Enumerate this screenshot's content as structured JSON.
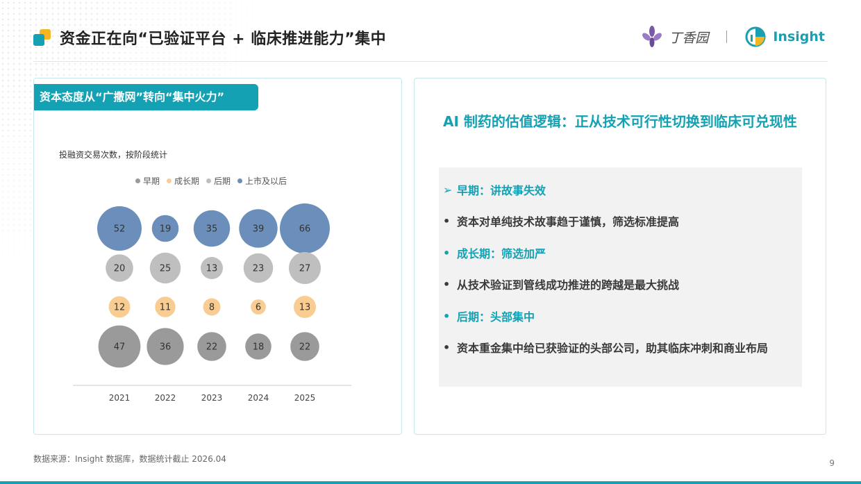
{
  "header": {
    "title": "资金正在向“已验证平台 + 临床推进能力”集中",
    "logo_lilac": "丁香园",
    "logo_insight": "Insight"
  },
  "left_panel": {
    "tag": "资本态度从“广撒网”转向“集中火力”",
    "chart_subtitle": "投融资交易易次数，按阶段统计"
  },
  "chart_data": {
    "type": "bubble",
    "subtitle": "投融资交易次数，按阶段统计",
    "categories": [
      "2021",
      "2022",
      "2023",
      "2024",
      "2025"
    ],
    "series": [
      {
        "name": "上市及以后",
        "color": "#6b8fba",
        "values": [
          52,
          19,
          35,
          39,
          66
        ]
      },
      {
        "name": "后期",
        "color": "#bfbfbf",
        "values": [
          20,
          25,
          13,
          23,
          27
        ]
      },
      {
        "name": "成长期",
        "color": "#f9cc92",
        "values": [
          12,
          11,
          8,
          6,
          13
        ]
      },
      {
        "name": "早期",
        "color": "#9a9a9a",
        "values": [
          47,
          36,
          22,
          18,
          22
        ]
      }
    ],
    "legend_order": [
      "早期",
      "成长期",
      "后期",
      "上市及以后"
    ],
    "legend_placement": "top",
    "grid": false
  },
  "right_panel": {
    "heading": "AI 制药的估值逻辑：正从技术可行性切换到临床可兑现性",
    "bullets": [
      {
        "marker": "➢",
        "text": "早期：讲故事失效",
        "highlight": true
      },
      {
        "marker": "•",
        "text": "资本对单纯技术故事趋于谨慎，筛选标准提高",
        "highlight": false
      },
      {
        "marker": "•",
        "text": "成长期：筛选加严",
        "highlight": true
      },
      {
        "marker": "•",
        "text": "从技术验证到管线成功推进的跨越是最大挑战",
        "highlight": false
      },
      {
        "marker": "•",
        "text": "后期：头部集中",
        "highlight": true
      },
      {
        "marker": "•",
        "text": "资本重金集中给已获验证的头部公司，助其临床冲刺和商业布局",
        "highlight": false
      }
    ]
  },
  "footer": {
    "source": "数据来源：Insight 数据库，数据统计截止 2026.04",
    "page_number": "9"
  },
  "colors": {
    "accent": "#13a1b3",
    "panel_border": "#c6e7ec"
  }
}
